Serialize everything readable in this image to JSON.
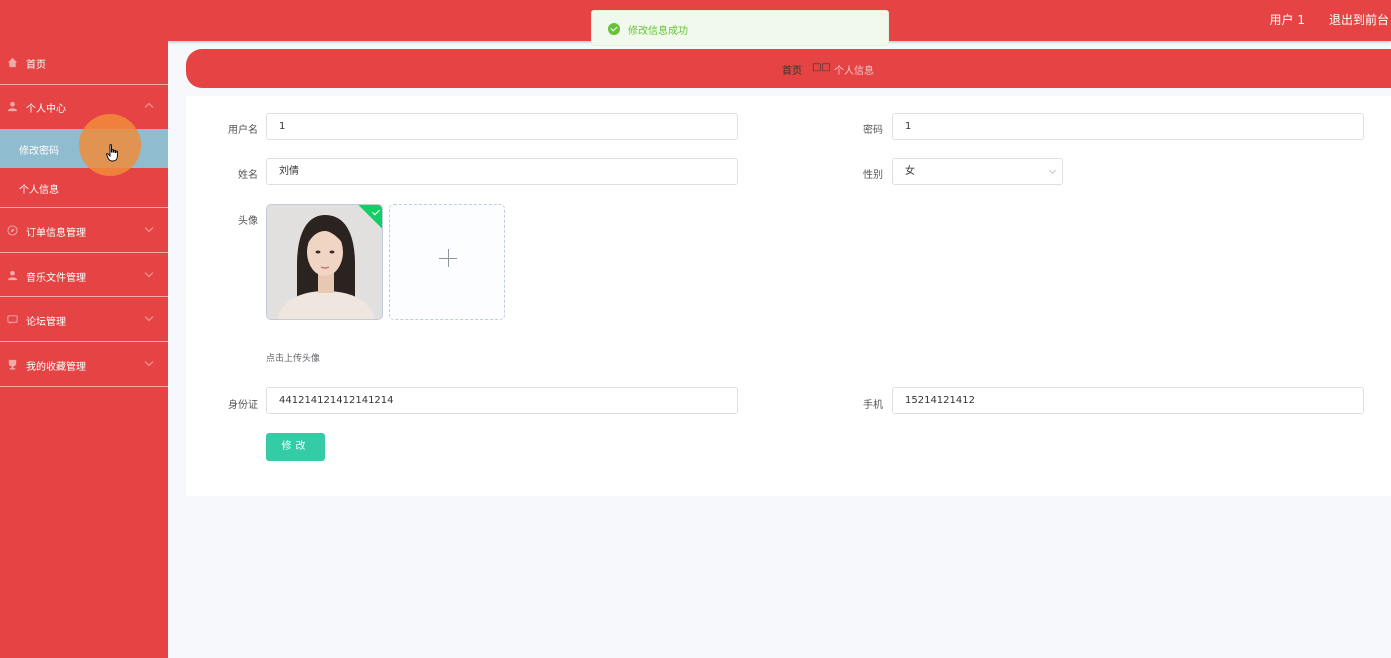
{
  "header": {
    "user": "用户 1",
    "logout": "退出到前台"
  },
  "toast": {
    "message": "修改信息成功"
  },
  "sidebar": {
    "items": [
      {
        "label": "首页",
        "icon": "home-icon"
      },
      {
        "label": "个人中心",
        "icon": "user-icon",
        "expanded": true,
        "children": [
          {
            "label": "修改密码",
            "active": true
          },
          {
            "label": "个人信息"
          }
        ]
      },
      {
        "label": "订单信息管理",
        "icon": "compass-icon"
      },
      {
        "label": "音乐文件管理",
        "icon": "user-icon"
      },
      {
        "label": "论坛管理",
        "icon": "chat-icon"
      },
      {
        "label": "我的收藏管理",
        "icon": "trophy-icon"
      }
    ]
  },
  "breadcrumb": {
    "home": "首页",
    "separator": "□□",
    "current": "个人信息"
  },
  "form": {
    "username_label": "用户名",
    "username_value": "1",
    "password_label": "密码",
    "password_value": "1",
    "name_label": "姓名",
    "name_value": "刘倩",
    "gender_label": "性别",
    "gender_value": "女",
    "avatar_label": "头像",
    "upload_tip": "点击上传头像",
    "idcard_label": "身份证",
    "idcard_value": "441214121412141214",
    "phone_label": "手机",
    "phone_value": "15214121412",
    "submit_label": "修改"
  },
  "colors": {
    "primary_red": "#e64444",
    "submit_teal": "#33cca6",
    "success_green": "#67c23a",
    "active_submenu": "#8fbccf"
  }
}
